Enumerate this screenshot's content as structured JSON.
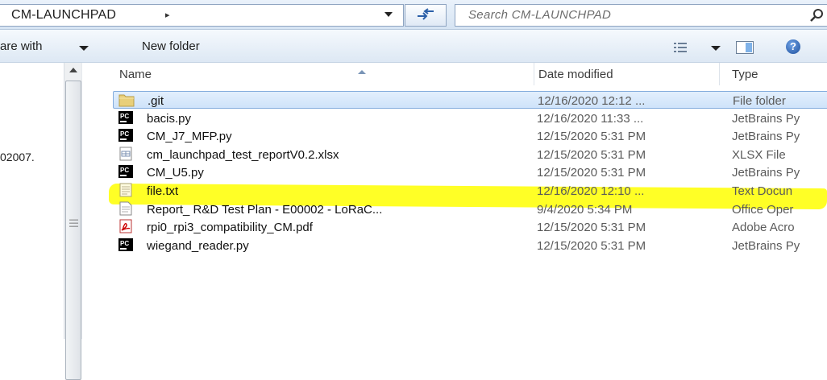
{
  "address": {
    "path": "CM-LAUNCHPAD",
    "separator": "▸",
    "search_placeholder": "Search CM-LAUNCHPAD"
  },
  "toolbar": {
    "share_label": "are with",
    "new_folder_label": "New folder"
  },
  "nav": {
    "visible_item": "02007."
  },
  "columns": {
    "name": "Name",
    "date": "Date modified",
    "type": "Type"
  },
  "files": [
    {
      "name": ".git",
      "date": "12/16/2020 12:12 ...",
      "type": "File folder",
      "icon": "folder-icon",
      "selected": true
    },
    {
      "name": "bacis.py",
      "date": "12/16/2020 11:33 ...",
      "type": "JetBrains Py",
      "icon": "pycharm-icon"
    },
    {
      "name": "CM_J7_MFP.py",
      "date": "12/15/2020 5:31 PM",
      "type": "JetBrains Py",
      "icon": "pycharm-icon"
    },
    {
      "name": "cm_launchpad_test_reportV0.2.xlsx",
      "date": "12/15/2020 5:31 PM",
      "type": "XLSX File",
      "icon": "spreadsheet-icon"
    },
    {
      "name": "CM_U5.py",
      "date": "12/15/2020 5:31 PM",
      "type": "JetBrains Py",
      "icon": "pycharm-icon"
    },
    {
      "name": "file.txt",
      "date": "12/16/2020 12:10 ...",
      "type": "Text Docun",
      "icon": "text-file-icon",
      "highlighted": true
    },
    {
      "name": "Report_ R&D Test Plan - E00002 - LoRaC...",
      "date": "9/4/2020 5:34 PM",
      "type": "Office Oper",
      "icon": "document-icon"
    },
    {
      "name": "rpi0_rpi3_compatibility_CM.pdf",
      "date": "12/15/2020 5:31 PM",
      "type": "Adobe Acro",
      "icon": "pdf-icon"
    },
    {
      "name": "wiegand_reader.py",
      "date": "12/15/2020 5:31 PM",
      "type": "JetBrains Py",
      "icon": "pycharm-icon"
    }
  ],
  "colors": {
    "selection": "#cfe3fa",
    "highlight": "#ffff00",
    "chrome": "#dde8f4"
  }
}
